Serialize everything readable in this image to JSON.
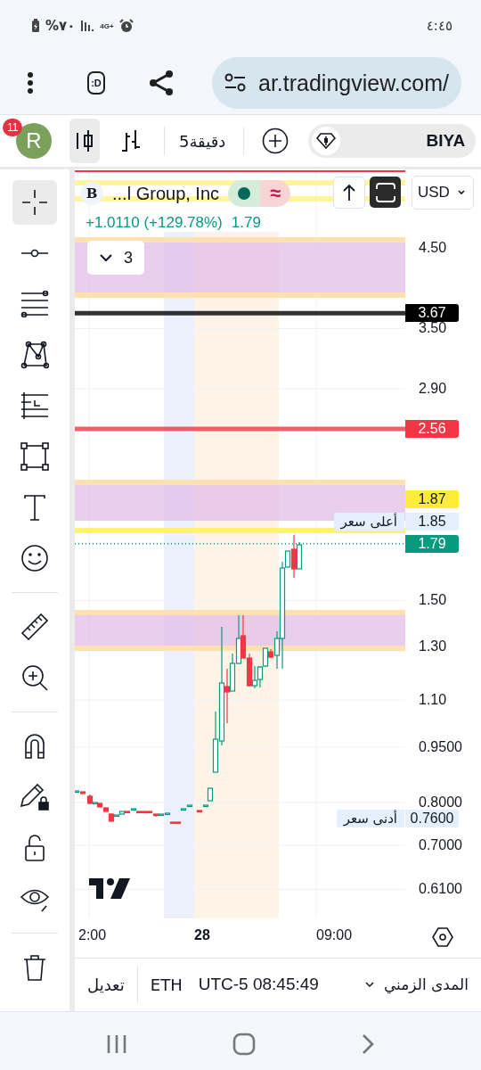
{
  "status_bar": {
    "time": "٤:٤٥",
    "battery": "%٧٠",
    "network": "4G+"
  },
  "browser": {
    "tab_icon": ":D",
    "url": "ar.tradingview.com/"
  },
  "toolbar": {
    "avatar": "R",
    "notifications": "11",
    "chart_styles": [
      {
        "kind": "candles",
        "selected": true
      },
      {
        "kind": "bars",
        "selected": false
      }
    ],
    "interval": "5دقيقة",
    "symbol": "BIYA"
  },
  "tool_groups": [
    [
      {
        "kind": "crosshair",
        "selected": true
      },
      {
        "kind": "trend-line",
        "selected": false
      },
      {
        "kind": "fib",
        "selected": false
      },
      {
        "kind": "pattern",
        "selected": false
      },
      {
        "kind": "position",
        "selected": false
      },
      {
        "kind": "rectangle",
        "selected": false
      },
      {
        "kind": "text",
        "selected": false
      },
      {
        "kind": "emoji",
        "selected": false
      }
    ],
    [
      {
        "kind": "ruler",
        "selected": false
      },
      {
        "kind": "zoom-in",
        "selected": false
      }
    ],
    [
      {
        "kind": "magnet",
        "selected": false
      },
      {
        "kind": "pencil-lock",
        "selected": false
      },
      {
        "kind": "unlock",
        "selected": false
      },
      {
        "kind": "eye",
        "selected": false
      }
    ],
    [
      {
        "kind": "trash",
        "selected": false
      }
    ]
  ],
  "legend": {
    "logo": "B",
    "name": "...l Group, Inc",
    "status_symbol": "≈",
    "change": "+1.0110 (+129.78%)",
    "price": "1.79",
    "indicators_count": "3",
    "currency": "USD"
  },
  "price_axis": [
    "4.50",
    "3.50",
    "2.90",
    "1.50",
    "1.30",
    "1.10",
    "0.9500",
    "0.8000",
    "0.7000",
    "0.6100"
  ],
  "price_markers": [
    {
      "kind": "line",
      "value": "3.67",
      "color": "#000000"
    },
    {
      "kind": "line",
      "value": "2.56",
      "color": "#f23645"
    },
    {
      "kind": "alert",
      "value": "1.87",
      "color": "#ffeb3b"
    },
    {
      "kind": "high",
      "label": "أعلى سعر",
      "value": "1.85",
      "color": "#e3effd"
    },
    {
      "kind": "last",
      "value": "1.79",
      "color": "#089981"
    },
    {
      "kind": "low",
      "label": "أدنى سعر",
      "value": "0.7600",
      "color": "#e3effd"
    }
  ],
  "time_axis": [
    {
      "kind": "time",
      "text": "2:00"
    },
    {
      "kind": "day",
      "text": "28"
    },
    {
      "kind": "time",
      "text": "09:00"
    }
  ],
  "bottom_bar": {
    "edit": "تعديل",
    "session": "ETH",
    "clock": "UTC-5 08:45:49",
    "range": "المدى الزمني"
  }
}
